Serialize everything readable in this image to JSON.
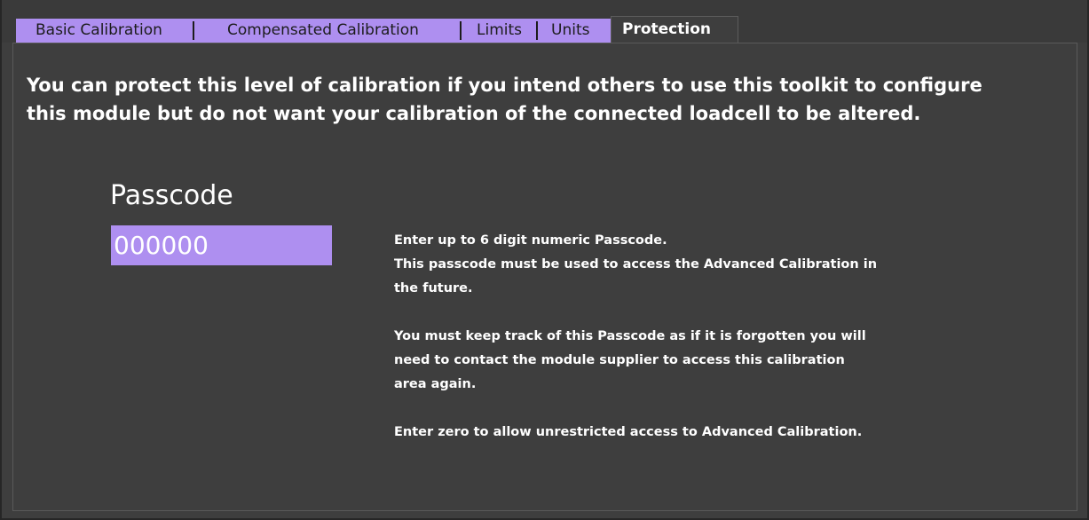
{
  "tabs": [
    {
      "label": "Basic Calibration",
      "active": false
    },
    {
      "label": "Compensated Calibration",
      "active": false
    },
    {
      "label": "Limits",
      "active": false
    },
    {
      "label": "Units",
      "active": false
    },
    {
      "label": "Protection",
      "active": true
    }
  ],
  "protection": {
    "intro_line1": "You can protect this level of calibration if you intend others to use this toolkit to configure",
    "intro_line2": "this module but do not want your calibration of the connected loadcell to be altered.",
    "passcode_label": "Passcode",
    "passcode_value": "000000",
    "help": {
      "p1_line1": "Enter up to 6 digit numeric Passcode.",
      "p1_line2": "This passcode must be used to access the Advanced Calibration in",
      "p1_line3": "the future.",
      "p2_line1": "You must keep track of this Passcode as if it is forgotten you will",
      "p2_line2": "need to contact the module supplier to access this calibration",
      "p2_line3": "area again.",
      "p3_line1": "Enter zero to allow unrestricted access to Advanced Calibration."
    }
  },
  "colors": {
    "tab_background": "#ae8ff0",
    "panel_background": "#3e3e3e",
    "input_background": "#ae8ff0",
    "text": "#ffffff"
  }
}
